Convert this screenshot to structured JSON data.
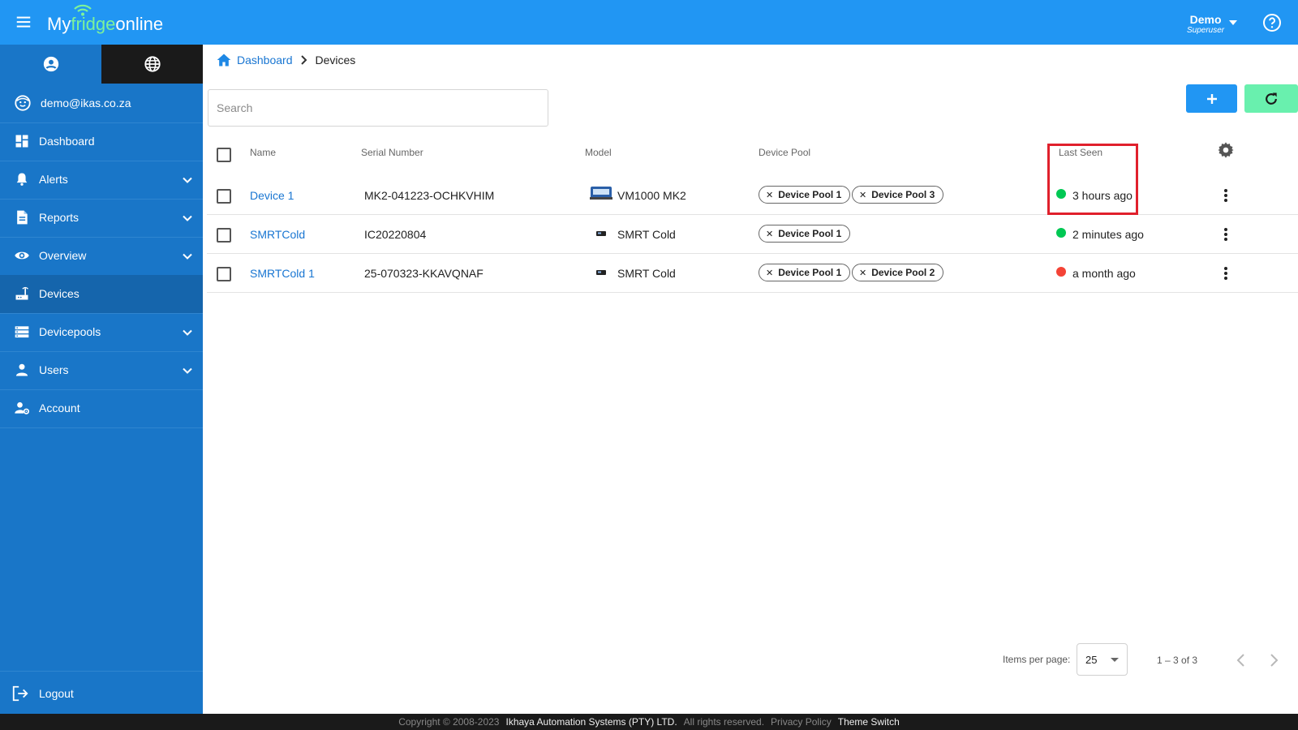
{
  "header": {
    "logo_my": "My",
    "logo_fridge": "fridge",
    "logo_online": "online",
    "user_name": "Demo",
    "user_role": "Superuser"
  },
  "sidebar": {
    "email": "demo@ikas.co.za",
    "items": [
      {
        "label": "Dashboard",
        "icon": "dashboard-icon",
        "expandable": false
      },
      {
        "label": "Alerts",
        "icon": "bell-icon",
        "expandable": true
      },
      {
        "label": "Reports",
        "icon": "report-icon",
        "expandable": true
      },
      {
        "label": "Overview",
        "icon": "eye-icon",
        "expandable": true
      },
      {
        "label": "Devices",
        "icon": "router-icon",
        "expandable": false
      },
      {
        "label": "Devicepools",
        "icon": "storage-icon",
        "expandable": true
      },
      {
        "label": "Users",
        "icon": "person-icon",
        "expandable": true
      },
      {
        "label": "Account",
        "icon": "manage-account-icon",
        "expandable": false
      }
    ],
    "active": "Devices",
    "logout": "Logout"
  },
  "breadcrumb": {
    "home": "Dashboard",
    "current": "Devices"
  },
  "search": {
    "placeholder": "Search",
    "value": ""
  },
  "table": {
    "columns": {
      "name": "Name",
      "serial": "Serial Number",
      "model": "Model",
      "pool": "Device Pool",
      "last_seen": "Last Seen"
    },
    "rows": [
      {
        "name": "Device 1",
        "serial": "MK2-041223-OCHKVHIM",
        "model": "VM1000 MK2",
        "pools": [
          "Device Pool 1",
          "Device Pool 3"
        ],
        "last_seen": "3 hours ago",
        "status": "online"
      },
      {
        "name": "SMRTCold",
        "serial": "IC20220804",
        "model": "SMRT Cold",
        "pools": [
          "Device Pool 1"
        ],
        "last_seen": "2 minutes ago",
        "status": "online"
      },
      {
        "name": "SMRTCold 1",
        "serial": "25-070323-KKAVQNAF",
        "model": "SMRT Cold",
        "pools": [
          "Device Pool 1",
          "Device Pool 2"
        ],
        "last_seen": "a month ago",
        "status": "offline"
      }
    ]
  },
  "paginator": {
    "label": "Items per page:",
    "page_size": "25",
    "range": "1 – 3 of 3"
  },
  "footer": {
    "copyright": "Copyright © 2008-2023",
    "company": "Ikhaya Automation Systems (PTY) LTD.",
    "rights": "All rights reserved.",
    "privacy": "Privacy Policy",
    "theme": "Theme Switch"
  },
  "colors": {
    "primary": "#2196f3",
    "sidebar": "#1976c8",
    "online": "#00c853",
    "offline": "#f44336",
    "refresh": "#69f0ae",
    "highlight": "#e0202c"
  }
}
